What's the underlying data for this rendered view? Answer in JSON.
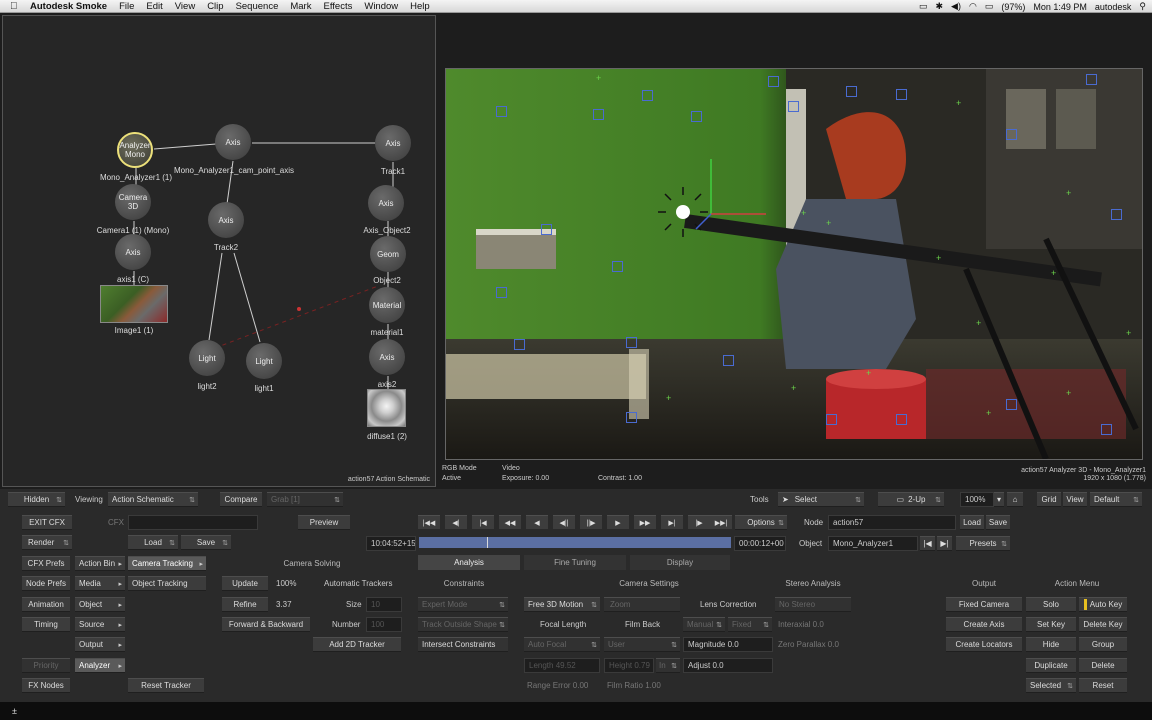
{
  "menubar": {
    "app_name": "Autodesk Smoke",
    "items": [
      "File",
      "Edit",
      "View",
      "Clip",
      "Sequence",
      "Mark",
      "Effects",
      "Window",
      "Help"
    ],
    "battery": "(97%)",
    "clock": "Mon 1:49 PM",
    "user": "autodesk"
  },
  "schematic": {
    "footer": "action57 Action Schematic",
    "nodes": {
      "analyzer": "Analyzer Mono",
      "axis_top": "Axis",
      "axis_right": "Axis",
      "camera": "Camera 3D",
      "axis_mid": "Axis",
      "axis_c": "Axis",
      "axis_obj2": "Axis",
      "geom": "Geom",
      "material": "Material",
      "axis_bottom": "Axis",
      "light1": "Light",
      "light2": "Light"
    },
    "labels": {
      "analyzer": "Mono_Analyzer1 (1)",
      "axis_top": "Mono_Analyzer1_cam_point_axis",
      "track1": "Track1",
      "camera": "Camera1 (1) (Mono)",
      "track2": "Track2",
      "axis_obj2": "Axis_Object2",
      "axis_c": "axis1 (C)",
      "object2": "Object2",
      "image1": "Image1 (1)",
      "material1": "material1",
      "light2": "light2",
      "light1": "light1",
      "axis2": "axis2",
      "diffuse1": "diffuse1 (2)"
    }
  },
  "viewer": {
    "rgb_mode": "RGB Mode",
    "active": "Active",
    "video": "Video",
    "exposure": "Exposure: 0.00",
    "contrast": "Contrast: 1.00",
    "title": "action57 Analyzer 3D - Mono_Analyzer1",
    "resolution": "1920 x 1080 (1.778)"
  },
  "toolbar": {
    "hidden": "Hidden",
    "viewing_label": "Viewing",
    "viewing_value": "Action Schematic",
    "compare": "Compare",
    "grab": "Grab [1]",
    "tools_label": "Tools",
    "select": "Select",
    "layout": "2-Up",
    "zoom": "100%",
    "grid": "Grid",
    "view": "View",
    "default": "Default"
  },
  "transport": {
    "exit": "EXIT CFX",
    "cfx_label": "CFX",
    "preview": "Preview",
    "options": "Options",
    "node_label": "Node",
    "node_value": "action57",
    "load": "Load",
    "save": "Save",
    "render": "Render",
    "load2": "Load",
    "save2": "Save",
    "timecode_in": "10:04:52+15",
    "timecode_dur": "00:00:12+00",
    "object_label": "Object",
    "object_value": "Mono_Analyzer1",
    "presets": "Presets"
  },
  "left_menu": {
    "cfx_prefs": "CFX Prefs",
    "action_bin": "Action Bin",
    "node_prefs": "Node Prefs",
    "media": "Media",
    "animation": "Animation",
    "object": "Object",
    "timing": "Timing",
    "source": "Source",
    "output": "Output",
    "priority": "Priority",
    "analyzer": "Analyzer",
    "fx_nodes": "FX Nodes",
    "camera_tracking": "Camera Tracking",
    "object_tracking": "Object Tracking",
    "reset_tracker": "Reset Tracker"
  },
  "camera_solving": {
    "header": "Camera Solving",
    "update": "Update",
    "update_val": "100%",
    "refine": "Refine",
    "refine_val": "3.37",
    "fwd_back": "Forward & Backward",
    "auto_trackers": "Automatic Trackers",
    "size_label": "Size",
    "size_val": "10",
    "number_label": "Number",
    "number_val": "100",
    "add_2d": "Add 2D Tracker"
  },
  "tabs": {
    "analysis": "Analysis",
    "fine_tuning": "Fine Tuning",
    "display": "Display"
  },
  "analysis": {
    "constraints_hdr": "Constraints",
    "expert_mode": "Expert Mode",
    "track_outside": "Track Outside Shape",
    "intersect": "Intersect Constraints",
    "cam_settings_hdr": "Camera Settings",
    "free_3d": "Free 3D Motion",
    "zoom": "Zoom",
    "focal_length_hdr": "Focal Length",
    "auto_focal": "Auto Focal",
    "length": "Length 49.52",
    "range_error": "Range Error 0.00",
    "film_back_hdr": "Film Back",
    "user": "User",
    "height": "Height 0.79",
    "in": "In",
    "film_ratio": "Film Ratio 1.00",
    "lens_hdr": "Lens Correction",
    "manual": "Manual",
    "fixed": "Fixed",
    "magnitude": "Magnitude 0.0",
    "adjust": "Adjust 0.0",
    "stereo_hdr": "Stereo Analysis",
    "no_stereo": "No Stereo",
    "interaxial": "Interaxial 0.0",
    "zero_parallax": "Zero Parallax 0.0"
  },
  "output": {
    "header": "Output",
    "fixed_camera": "Fixed Camera",
    "create_axis": "Create Axis",
    "create_locators": "Create Locators"
  },
  "action_menu": {
    "header": "Action Menu",
    "solo": "Solo",
    "auto_key": "Auto Key",
    "set_key": "Set Key",
    "delete_key": "Delete Key",
    "hide": "Hide",
    "group": "Group",
    "duplicate": "Duplicate",
    "delete": "Delete",
    "selected": "Selected",
    "reset": "Reset"
  },
  "bottom": {
    "glyph": "±"
  }
}
